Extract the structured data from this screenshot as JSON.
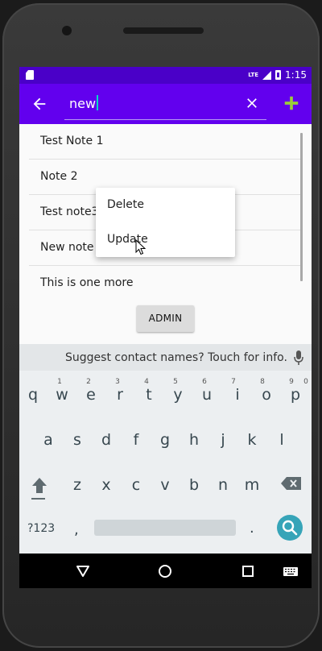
{
  "status_bar": {
    "network_label": "LTE",
    "time": "1:15",
    "color": "#4a00c8"
  },
  "app_bar": {
    "search_value": "new",
    "back_icon": "arrow-left-icon",
    "clear_icon": "close-icon",
    "add_icon": "plus-icon",
    "color": "#6200ee",
    "add_icon_color": "#9bcc3a"
  },
  "notes": [
    {
      "title": "Test Note 1"
    },
    {
      "title": "Note 2"
    },
    {
      "title": "Test note3"
    },
    {
      "title": "New note update"
    },
    {
      "title": "This is one more"
    }
  ],
  "context_menu": {
    "items": [
      {
        "label": "Delete"
      },
      {
        "label": "Update"
      }
    ]
  },
  "admin_button": {
    "label": "ADMIN"
  },
  "keyboard": {
    "suggestion": "Suggest contact names? Touch for info.",
    "row1": [
      {
        "key": "q",
        "hint": "1"
      },
      {
        "key": "w",
        "hint": "2"
      },
      {
        "key": "e",
        "hint": "3"
      },
      {
        "key": "r",
        "hint": "4"
      },
      {
        "key": "t",
        "hint": "5"
      },
      {
        "key": "y",
        "hint": "6"
      },
      {
        "key": "u",
        "hint": "7"
      },
      {
        "key": "i",
        "hint": "8"
      },
      {
        "key": "o",
        "hint": "9"
      },
      {
        "key": "p",
        "hint": "0"
      }
    ],
    "row2": [
      "a",
      "s",
      "d",
      "f",
      "g",
      "h",
      "j",
      "k",
      "l"
    ],
    "row3": [
      "z",
      "x",
      "c",
      "v",
      "b",
      "n",
      "m"
    ],
    "symbols_label": "?123",
    "comma": ",",
    "period": ".",
    "search_key_color": "#36a4b8"
  },
  "nav_bar": {
    "back_icon": "triangle-back-icon",
    "home_icon": "circle-home-icon",
    "recents_icon": "square-recents-icon",
    "keyboard_icon": "keyboard-icon"
  }
}
